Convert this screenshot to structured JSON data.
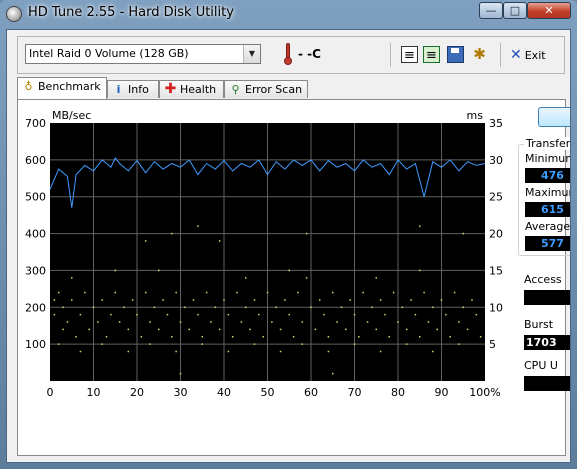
{
  "window": {
    "title": "HD Tune 2.55 - Hard Disk Utility",
    "controls": {
      "minimize": "—",
      "maximize": "□",
      "close": "✕"
    }
  },
  "toolbar": {
    "drive_select": "Intel   Raid 0 Volume (128 GB)",
    "temperature": "- -C",
    "exit_label": "Exit",
    "icons": [
      "copy-text-icon",
      "copy-screenshot-icon",
      "save-icon",
      "options-icon"
    ]
  },
  "tabs": [
    {
      "label": "Benchmark",
      "icon": "stopwatch-icon",
      "active": true
    },
    {
      "label": "Info",
      "icon": "info-icon",
      "active": false
    },
    {
      "label": "Health",
      "icon": "health-cross-icon",
      "active": false
    },
    {
      "label": "Error Scan",
      "icon": "magnifier-icon",
      "active": false
    }
  ],
  "benchmark": {
    "start_label": "",
    "transfer_group": "Transfer",
    "minimum_label": "Minimum",
    "minimum_value": "476",
    "maximum_label": "Maximum",
    "maximum_value": "615",
    "average_label": "Average",
    "average_value": "577",
    "access_label": "Access",
    "access_value": "",
    "burst_label": "Burst",
    "burst_value": "1703",
    "cpu_label": "CPU U",
    "cpu_value": ""
  },
  "chart_data": {
    "type": "line",
    "left_axis": {
      "unit": "MB/sec",
      "ticks": [
        700,
        600,
        500,
        400,
        300,
        200,
        100
      ],
      "range": [
        0,
        700
      ]
    },
    "right_axis": {
      "unit": "ms",
      "ticks": [
        35,
        30,
        25,
        20,
        15,
        10,
        5
      ],
      "range": [
        0,
        35
      ]
    },
    "x_axis": {
      "ticks": [
        "0",
        "10",
        "20",
        "30",
        "40",
        "50",
        "60",
        "70",
        "80",
        "90",
        "100%"
      ],
      "range": [
        0,
        100
      ]
    },
    "background": "#000000",
    "grid": true,
    "grid_color": "#5f5f5f",
    "series": [
      {
        "role": "transfer rate (MB/sec)",
        "color": "#3d9bff",
        "x": [
          0,
          2,
          4,
          5,
          6,
          8,
          10,
          12,
          14,
          15,
          16,
          18,
          20,
          22,
          24,
          26,
          28,
          30,
          32,
          34,
          36,
          38,
          40,
          42,
          44,
          46,
          48,
          50,
          52,
          54,
          56,
          58,
          60,
          62,
          64,
          66,
          68,
          70,
          72,
          74,
          76,
          78,
          80,
          82,
          84,
          86,
          88,
          90,
          92,
          94,
          96,
          98,
          100
        ],
        "values": [
          520,
          575,
          555,
          470,
          560,
          585,
          570,
          600,
          580,
          605,
          590,
          570,
          598,
          565,
          595,
          575,
          590,
          580,
          600,
          560,
          590,
          575,
          598,
          570,
          590,
          580,
          600,
          560,
          595,
          575,
          600,
          585,
          600,
          570,
          598,
          580,
          590,
          570,
          600,
          580,
          590,
          560,
          600,
          575,
          590,
          500,
          595,
          580,
          600,
          570,
          595,
          585,
          590
        ]
      },
      {
        "role": "access time (ms)",
        "color": "#d8d46a",
        "points": [
          [
            1,
            11
          ],
          [
            1,
            9
          ],
          [
            2,
            12
          ],
          [
            3,
            7
          ],
          [
            3,
            10
          ],
          [
            4,
            8
          ],
          [
            5,
            11
          ],
          [
            6,
            6
          ],
          [
            7,
            9
          ],
          [
            8,
            12
          ],
          [
            9,
            7
          ],
          [
            10,
            10
          ],
          [
            11,
            8
          ],
          [
            12,
            11
          ],
          [
            13,
            6
          ],
          [
            14,
            9
          ],
          [
            15,
            12
          ],
          [
            16,
            8
          ],
          [
            17,
            10
          ],
          [
            18,
            7
          ],
          [
            19,
            11
          ],
          [
            20,
            9
          ],
          [
            21,
            6
          ],
          [
            22,
            12
          ],
          [
            23,
            8
          ],
          [
            24,
            10
          ],
          [
            25,
            7
          ],
          [
            26,
            11
          ],
          [
            27,
            9
          ],
          [
            28,
            6
          ],
          [
            29,
            12
          ],
          [
            30,
            8
          ],
          [
            31,
            10
          ],
          [
            32,
            7
          ],
          [
            33,
            11
          ],
          [
            34,
            9
          ],
          [
            35,
            6
          ],
          [
            36,
            12
          ],
          [
            37,
            8
          ],
          [
            38,
            10
          ],
          [
            39,
            7
          ],
          [
            40,
            11
          ],
          [
            41,
            9
          ],
          [
            42,
            6
          ],
          [
            43,
            12
          ],
          [
            44,
            8
          ],
          [
            45,
            10
          ],
          [
            46,
            7
          ],
          [
            47,
            11
          ],
          [
            48,
            9
          ],
          [
            49,
            6
          ],
          [
            50,
            12
          ],
          [
            51,
            8
          ],
          [
            52,
            10
          ],
          [
            53,
            7
          ],
          [
            54,
            11
          ],
          [
            55,
            9
          ],
          [
            56,
            6
          ],
          [
            57,
            12
          ],
          [
            58,
            8
          ],
          [
            59,
            14
          ],
          [
            60,
            10
          ],
          [
            61,
            7
          ],
          [
            62,
            11
          ],
          [
            63,
            9
          ],
          [
            64,
            6
          ],
          [
            65,
            12
          ],
          [
            66,
            8
          ],
          [
            67,
            10
          ],
          [
            68,
            7
          ],
          [
            69,
            11
          ],
          [
            70,
            9
          ],
          [
            71,
            6
          ],
          [
            72,
            12
          ],
          [
            73,
            8
          ],
          [
            74,
            10
          ],
          [
            75,
            7
          ],
          [
            76,
            11
          ],
          [
            77,
            9
          ],
          [
            78,
            6
          ],
          [
            79,
            12
          ],
          [
            80,
            8
          ],
          [
            81,
            10
          ],
          [
            82,
            7
          ],
          [
            83,
            11
          ],
          [
            84,
            9
          ],
          [
            85,
            6
          ],
          [
            86,
            12
          ],
          [
            87,
            8
          ],
          [
            88,
            10
          ],
          [
            89,
            7
          ],
          [
            90,
            11
          ],
          [
            91,
            9
          ],
          [
            92,
            6
          ],
          [
            93,
            12
          ],
          [
            94,
            8
          ],
          [
            95,
            10
          ],
          [
            96,
            7
          ],
          [
            97,
            11
          ],
          [
            98,
            9
          ],
          [
            99,
            6
          ],
          [
            2,
            5
          ],
          [
            7,
            4
          ],
          [
            12,
            5
          ],
          [
            18,
            4
          ],
          [
            23,
            5
          ],
          [
            29,
            4
          ],
          [
            35,
            5
          ],
          [
            41,
            4
          ],
          [
            47,
            5
          ],
          [
            53,
            4
          ],
          [
            58,
            5
          ],
          [
            64,
            4
          ],
          [
            70,
            5
          ],
          [
            76,
            4
          ],
          [
            82,
            5
          ],
          [
            88,
            4
          ],
          [
            94,
            5
          ],
          [
            5,
            14
          ],
          [
            15,
            15
          ],
          [
            25,
            15
          ],
          [
            45,
            14
          ],
          [
            55,
            15
          ],
          [
            75,
            14
          ],
          [
            85,
            15
          ],
          [
            28,
            20
          ],
          [
            34,
            21
          ],
          [
            39,
            19
          ],
          [
            59,
            20
          ],
          [
            85,
            21
          ],
          [
            95,
            20
          ],
          [
            22,
            19
          ],
          [
            65,
            1
          ],
          [
            30,
            1
          ]
        ]
      }
    ]
  }
}
